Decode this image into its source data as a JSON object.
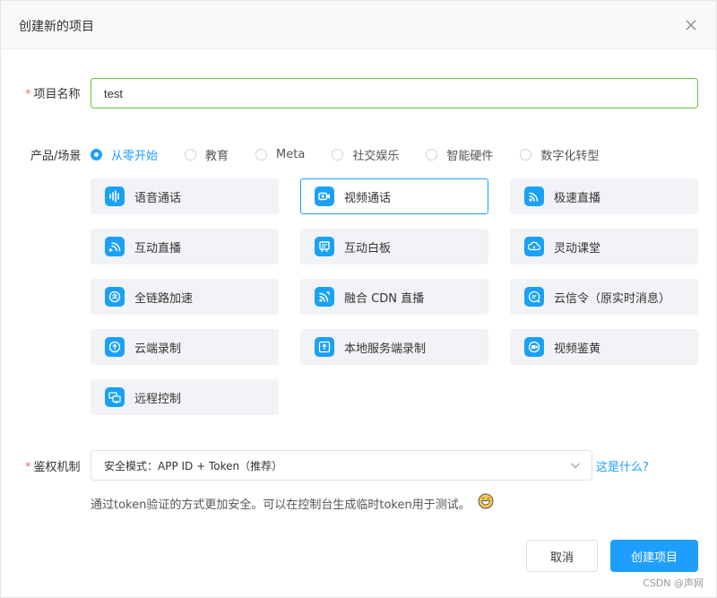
{
  "dialog": {
    "title": "创建新的项目",
    "close_icon": "close-icon"
  },
  "project_name": {
    "required_mark": "*",
    "label": "项目名称",
    "value": "test"
  },
  "scene": {
    "label": "产品/场景",
    "options": [
      {
        "label": "从零开始",
        "checked": true
      },
      {
        "label": "教育",
        "checked": false
      },
      {
        "label": "Meta",
        "checked": false
      },
      {
        "label": "社交娱乐",
        "checked": false
      },
      {
        "label": "智能硬件",
        "checked": false
      },
      {
        "label": "数字化转型",
        "checked": false
      }
    ]
  },
  "products": [
    {
      "label": "语音通话",
      "icon": "voice-wave-icon",
      "selected": false
    },
    {
      "label": "视频通话",
      "icon": "video-camera-icon",
      "selected": true
    },
    {
      "label": "极速直播",
      "icon": "live-signal-icon",
      "selected": false
    },
    {
      "label": "互动直播",
      "icon": "interactive-live-icon",
      "selected": false
    },
    {
      "label": "互动白板",
      "icon": "whiteboard-icon",
      "selected": false
    },
    {
      "label": "灵动课堂",
      "icon": "classroom-icon",
      "selected": false
    },
    {
      "label": "全链路加速",
      "icon": "acceleration-icon",
      "selected": false
    },
    {
      "label": "融合 CDN 直播",
      "icon": "cdn-live-icon",
      "selected": false
    },
    {
      "label": "云信令（原实时消息）",
      "icon": "signaling-message-icon",
      "selected": false
    },
    {
      "label": "云端录制",
      "icon": "cloud-record-icon",
      "selected": false
    },
    {
      "label": "本地服务端录制",
      "icon": "server-record-icon",
      "selected": false
    },
    {
      "label": "视频鉴黄",
      "icon": "video-moderation-icon",
      "selected": false
    },
    {
      "label": "远程控制",
      "icon": "remote-control-icon",
      "selected": false
    }
  ],
  "auth": {
    "required_mark": "*",
    "label": "鉴权机制",
    "selected": "安全模式：APP ID + Token（推荐）",
    "help_link": "这是什么?",
    "hint": "通过token验证的方式更加安全。可以在控制台生成临时token用于测试。",
    "hint_icon": "smile-emoji-icon"
  },
  "buttons": {
    "cancel": "取消",
    "create": "创建项目"
  },
  "watermark": "CSDN @声网",
  "colors": {
    "accent": "#1e9fff",
    "valid_border": "#67c23a",
    "required": "#f56c6c",
    "card_bg": "#f2f3f6",
    "icon_bg": "#1aa0f5"
  }
}
